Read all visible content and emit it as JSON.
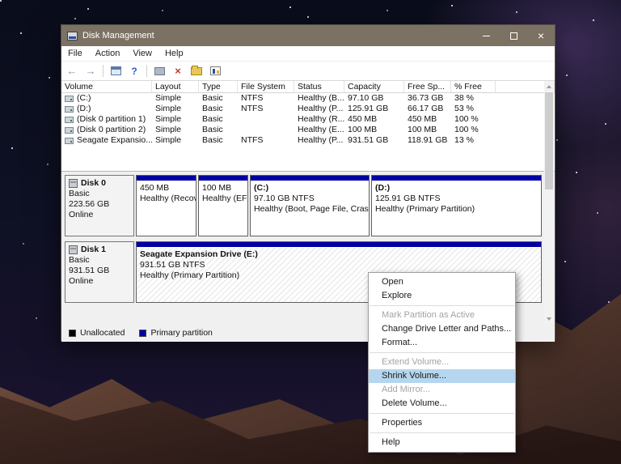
{
  "colors": {
    "titlebar": "#7b7263",
    "partition_band": "#0000a2",
    "menu_highlight": "#b5d6ee",
    "unallocated": "#000000",
    "primary_partition": "#0000a2"
  },
  "window": {
    "title": "Disk Management",
    "menu_items": [
      "File",
      "Action",
      "View",
      "Help"
    ]
  },
  "volume_table": {
    "columns": [
      "Volume",
      "Layout",
      "Type",
      "File System",
      "Status",
      "Capacity",
      "Free Sp...",
      "% Free"
    ],
    "rows": [
      [
        "(C:)",
        "Simple",
        "Basic",
        "NTFS",
        "Healthy (B...",
        "97.10 GB",
        "36.73 GB",
        "38 %"
      ],
      [
        "(D:)",
        "Simple",
        "Basic",
        "NTFS",
        "Healthy (P...",
        "125.91 GB",
        "66.17 GB",
        "53 %"
      ],
      [
        "(Disk 0 partition 1)",
        "Simple",
        "Basic",
        "",
        "Healthy (R...",
        "450 MB",
        "450 MB",
        "100 %"
      ],
      [
        "(Disk 0 partition 2)",
        "Simple",
        "Basic",
        "",
        "Healthy (E...",
        "100 MB",
        "100 MB",
        "100 %"
      ],
      [
        "Seagate Expansio...",
        "Simple",
        "Basic",
        "NTFS",
        "Healthy (P...",
        "931.51 GB",
        "118.91 GB",
        "13 %"
      ]
    ]
  },
  "disks": [
    {
      "name": "Disk 0",
      "kind": "Basic",
      "size": "223.56 GB",
      "status": "Online",
      "partitions": [
        {
          "title": "",
          "line1": "450 MB",
          "line2": "Healthy (Recove"
        },
        {
          "title": "",
          "line1": "100 MB",
          "line2": "Healthy (EF"
        },
        {
          "title": "(C:)",
          "line1": "97.10 GB NTFS",
          "line2": "Healthy (Boot, Page File, Crash Du"
        },
        {
          "title": "(D:)",
          "line1": "125.91 GB NTFS",
          "line2": "Healthy (Primary Partition)"
        }
      ]
    },
    {
      "name": "Disk 1",
      "kind": "Basic",
      "size": "931.51 GB",
      "status": "Online",
      "partitions": [
        {
          "title": "Seagate Expansion Drive  (E:)",
          "line1": "931.51 GB NTFS",
          "line2": "Healthy (Primary Partition)"
        }
      ]
    }
  ],
  "legend": [
    {
      "label": "Unallocated",
      "color": "#000000"
    },
    {
      "label": "Primary partition",
      "color": "#0000a2"
    }
  ],
  "context_menu": {
    "items": [
      {
        "label": "Open"
      },
      {
        "label": "Explore"
      },
      {
        "label": "Mark Partition as Active"
      },
      {
        "label": "Change Drive Letter and Paths..."
      },
      {
        "label": "Format..."
      },
      {
        "label": "Extend Volume..."
      },
      {
        "label": "Shrink Volume..."
      },
      {
        "label": "Add Mirror..."
      },
      {
        "label": "Delete Volume..."
      },
      {
        "label": "Properties"
      },
      {
        "label": "Help"
      }
    ]
  }
}
